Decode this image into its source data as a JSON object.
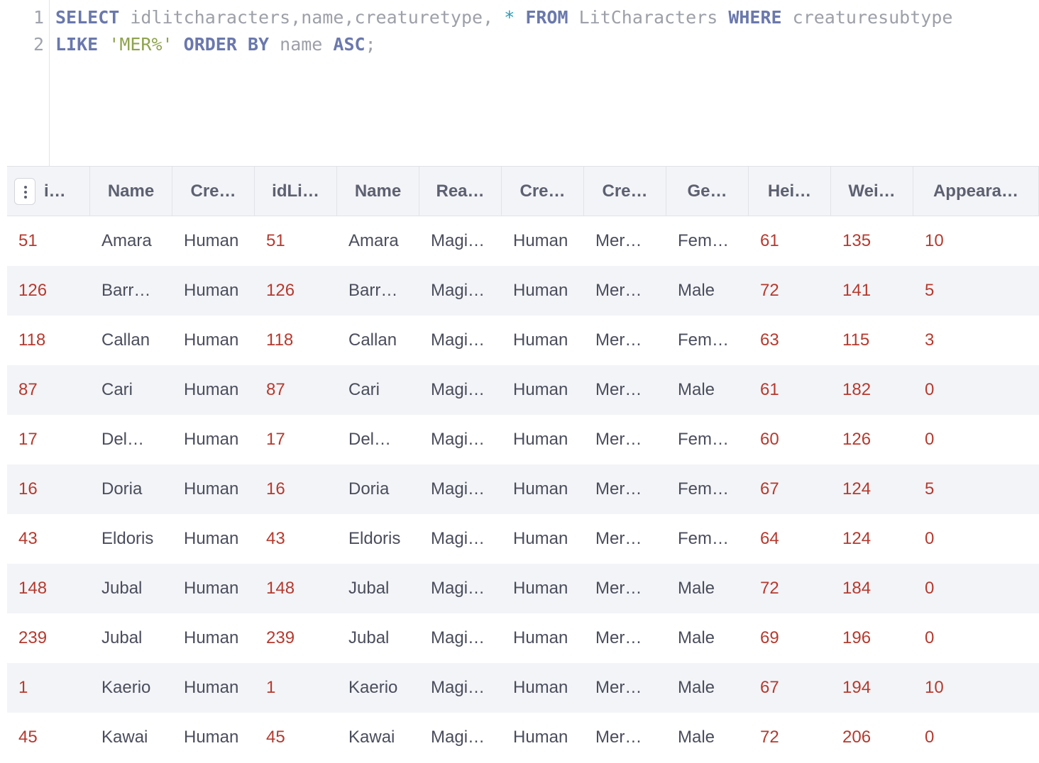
{
  "editor": {
    "line_numbers": [
      "1",
      "2"
    ],
    "line1": {
      "kw_select": "SELECT",
      "columns": "idlitcharacters,name,creaturetype,",
      "star": "*",
      "kw_from": "FROM",
      "table": "LitCharacters",
      "kw_where": "WHERE",
      "field": "creaturesubtype"
    },
    "line2": {
      "kw_like": "LIKE",
      "pattern": "'MER%'",
      "kw_order": "ORDER BY",
      "order_field": "name",
      "kw_asc": "ASC",
      "end": ";"
    }
  },
  "grid": {
    "headers": [
      "i…",
      "Name",
      "Cre…",
      "idLi…",
      "Name",
      "Rea…",
      "Cre…",
      "Cre…",
      "Ge…",
      "Hei…",
      "Wei…",
      "Appeara…"
    ],
    "rows": [
      [
        "51",
        "Amara",
        "Human",
        "51",
        "Amara",
        "Magi…",
        "Human",
        "Mer…",
        "Fem…",
        "61",
        "135",
        "10"
      ],
      [
        "126",
        "Barr…",
        "Human",
        "126",
        "Barr…",
        "Magi…",
        "Human",
        "Mer…",
        "Male",
        "72",
        "141",
        "5"
      ],
      [
        "118",
        "Callan",
        "Human",
        "118",
        "Callan",
        "Magi…",
        "Human",
        "Mer…",
        "Fem…",
        "63",
        "115",
        "3"
      ],
      [
        "87",
        "Cari",
        "Human",
        "87",
        "Cari",
        "Magi…",
        "Human",
        "Mer…",
        "Male",
        "61",
        "182",
        "0"
      ],
      [
        "17",
        "Del…",
        "Human",
        "17",
        "Del…",
        "Magi…",
        "Human",
        "Mer…",
        "Fem…",
        "60",
        "126",
        "0"
      ],
      [
        "16",
        "Doria",
        "Human",
        "16",
        "Doria",
        "Magi…",
        "Human",
        "Mer…",
        "Fem…",
        "67",
        "124",
        "5"
      ],
      [
        "43",
        "Eldoris",
        "Human",
        "43",
        "Eldoris",
        "Magi…",
        "Human",
        "Mer…",
        "Fem…",
        "64",
        "124",
        "0"
      ],
      [
        "148",
        "Jubal",
        "Human",
        "148",
        "Jubal",
        "Magi…",
        "Human",
        "Mer…",
        "Male",
        "72",
        "184",
        "0"
      ],
      [
        "239",
        "Jubal",
        "Human",
        "239",
        "Jubal",
        "Magi…",
        "Human",
        "Mer…",
        "Male",
        "69",
        "196",
        "0"
      ],
      [
        "1",
        "Kaerio",
        "Human",
        "1",
        "Kaerio",
        "Magi…",
        "Human",
        "Mer…",
        "Male",
        "67",
        "194",
        "10"
      ],
      [
        "45",
        "Kawai",
        "Human",
        "45",
        "Kawai",
        "Magi…",
        "Human",
        "Mer…",
        "Male",
        "72",
        "206",
        "0"
      ]
    ]
  },
  "colors": {
    "keyword": "#6a78ad",
    "string": "#8ea34e",
    "number_cell": "#b53a2f",
    "text_cell": "#4a4d5c",
    "header_bg": "#f3f4f7"
  },
  "icons": {
    "column_menu": "vertical-ellipsis-icon"
  }
}
